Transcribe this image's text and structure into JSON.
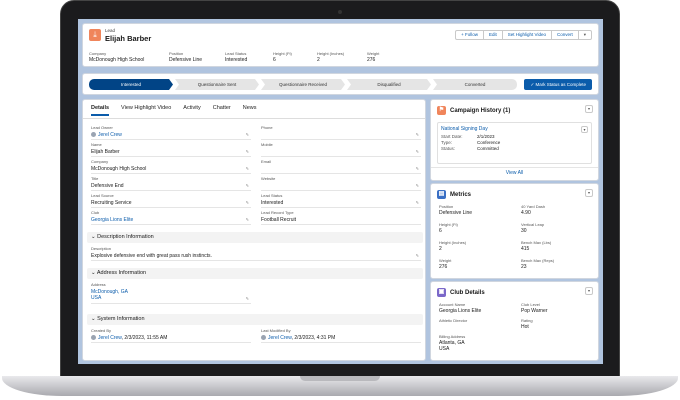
{
  "record": {
    "type": "Lead",
    "name": "Elijah Barber"
  },
  "buttons": {
    "follow": "+ Follow",
    "edit": "Edit",
    "highlight": "Set Highlight Video",
    "convert": "Convert",
    "more": "▾"
  },
  "header_fields": [
    {
      "label": "Company",
      "value": "McDonough High School"
    },
    {
      "label": "Position",
      "value": "Defensive Line"
    },
    {
      "label": "Lead Status",
      "value": "Interested"
    },
    {
      "label": "Height (Ft)",
      "value": "6"
    },
    {
      "label": "Height (Inches)",
      "value": "2"
    },
    {
      "label": "Weight",
      "value": "276"
    }
  ],
  "path": {
    "steps": [
      "Interested",
      "Questionnaire Sent",
      "Questionnaire Received",
      "Disqualified",
      "Converted"
    ],
    "mark_button": "✓ Mark Status as Complete"
  },
  "tabs": [
    "Details",
    "View Highlight Video",
    "Activity",
    "Chatter",
    "News"
  ],
  "details_left": [
    {
      "label": "Lead Owner",
      "value": "Jerel Crew",
      "link": true,
      "avatar": true
    },
    {
      "label": "Name",
      "value": "Elijah Barber"
    },
    {
      "label": "Company",
      "value": "McDonough High School"
    },
    {
      "label": "Title",
      "value": "Defensive End"
    },
    {
      "label": "Lead Source",
      "value": "Recruiting Service"
    },
    {
      "label": "Club",
      "value": "Georgia Lions Elite",
      "link": true
    }
  ],
  "details_right": [
    {
      "label": "Phone",
      "value": ""
    },
    {
      "label": "Mobile",
      "value": ""
    },
    {
      "label": "Email",
      "value": ""
    },
    {
      "label": "Website",
      "value": ""
    },
    {
      "label": "Lead Status",
      "value": "Interested"
    },
    {
      "label": "Lead Record Type",
      "value": "Football Recruit"
    }
  ],
  "sections": {
    "description": "Description Information",
    "address": "Address Information",
    "system": "System Information"
  },
  "description": {
    "label": "Description",
    "value": "Explosive defensive end with great pass rush instincts."
  },
  "address": {
    "label": "Address",
    "line1": "McDonough, GA",
    "line2": "USA"
  },
  "system": {
    "created_label": "Created By",
    "created_user": "Jerel Crew",
    "created_date": ", 2/3/2023, 11:55 AM",
    "modified_label": "Last Modified By",
    "modified_user": "Jerel Crew",
    "modified_date": ", 2/3/2023, 4:31 PM"
  },
  "campaign": {
    "title": "Campaign History (1)",
    "name": "National Signing Day",
    "rows": [
      {
        "label": "Start Date:",
        "value": "2/1/2023"
      },
      {
        "label": "Type:",
        "value": "Conference"
      },
      {
        "label": "Status:",
        "value": "Committed"
      }
    ],
    "view_all": "View All"
  },
  "metrics": {
    "title": "Metrics",
    "fields": [
      {
        "label": "Position",
        "value": "Defensive Line"
      },
      {
        "label": "40 Yard Dash",
        "value": "4.90"
      },
      {
        "label": "Height (Ft)",
        "value": "6"
      },
      {
        "label": "Vertical Leap",
        "value": "30"
      },
      {
        "label": "Height (Inches)",
        "value": "2"
      },
      {
        "label": "Bench Max (Lbs)",
        "value": "415"
      },
      {
        "label": "Weight",
        "value": "276"
      },
      {
        "label": "Bench Max (Reps)",
        "value": "23"
      }
    ]
  },
  "club": {
    "title": "Club Details",
    "fields": [
      {
        "label": "Account Name",
        "value": "Georgia Lions Elite"
      },
      {
        "label": "Club Level",
        "value": "Pop Warner"
      },
      {
        "label": "Athletic Director",
        "value": ""
      },
      {
        "label": "Rating",
        "value": "Hot"
      }
    ],
    "billing_label": "Billing Address",
    "billing_line1": "Atlanta, GA",
    "billing_line2": "USA"
  }
}
